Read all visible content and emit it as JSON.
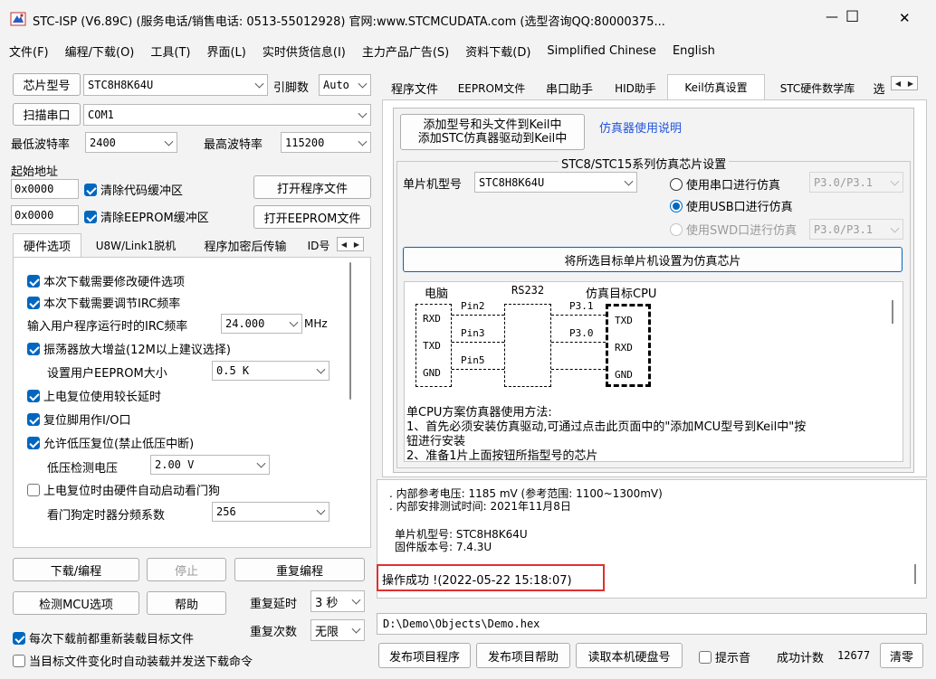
{
  "window": {
    "title": "STC-ISP (V6.89C) (服务电话/销售电话: 0513-55012928) 官网:www.STCMCUDATA.com  (选型咨询QQ:80000375...",
    "min_glyph": "—",
    "max_glyph": "☐",
    "close_glyph": "✕"
  },
  "menu": [
    "文件(F)",
    "编程/下载(O)",
    "工具(T)",
    "界面(L)",
    "实时供货信息(I)",
    "主力产品广告(S)",
    "资料下载(D)",
    "Simplified Chinese",
    "English"
  ],
  "left": {
    "chip_btn": "芯片型号",
    "chip_value": "STC8H8K64U",
    "pins_label": "引脚数",
    "pins_value": "Auto",
    "scan_btn": "扫描串口",
    "port_value": "COM1",
    "min_baud_label": "最低波特率",
    "min_baud_value": "2400",
    "max_baud_label": "最高波特率",
    "max_baud_value": "115200",
    "start_addr_label": "起始地址",
    "addr1": "0x0000",
    "clear_code": "清除代码缓冲区",
    "open_prog": "打开程序文件",
    "addr2": "0x0000",
    "clear_eeprom": "清除EEPROM缓冲区",
    "open_eeprom": "打开EEPROM文件",
    "tabs": [
      "硬件选项",
      "U8W/Link1脱机",
      "程序加密后传输",
      "ID号"
    ],
    "opts": {
      "o1": "本次下载需要修改硬件选项",
      "o2": "本次下载需要调节IRC频率",
      "irc_label": "输入用户程序运行时的IRC频率",
      "irc_value": "24.000",
      "irc_unit": "MHz",
      "o3": "振荡器放大增益(12M以上建议选择)",
      "eeprom_label": "设置用户EEPROM大小",
      "eeprom_value": "0.5 K",
      "o4": "上电复位使用较长延时",
      "o5": "复位脚用作I/O口",
      "o6": "允许低压复位(禁止低压中断)",
      "lv_label": "低压检测电压",
      "lv_value": "2.00 V",
      "o7": "上电复位时由硬件自动启动看门狗",
      "wdt_label": "看门狗定时器分频系数",
      "wdt_value": "256"
    },
    "download": "下载/编程",
    "stop": "停止",
    "reprogram": "重复编程",
    "check_mcu": "检测MCU选项",
    "help": "帮助",
    "repeat_delay_label": "重复延时",
    "repeat_delay_value": "3 秒",
    "repeat_count_label": "重复次数",
    "repeat_count_value": "无限",
    "reload1": "每次下载前都重新装载目标文件",
    "reload2": "当目标文件变化时自动装载并发送下载命令"
  },
  "right": {
    "tabs": [
      "程序文件",
      "EEPROM文件",
      "串口助手",
      "HID助手",
      "Keil仿真设置",
      "STC硬件数学库",
      "选"
    ],
    "keil_btn_line1": "添加型号和头文件到Keil中",
    "keil_btn_line2": "添加STC仿真器驱动到Keil中",
    "emu_link": "仿真器使用说明",
    "group_title": "STC8/STC15系列仿真芯片设置",
    "mcu_label": "单片机型号",
    "mcu_value": "STC8H8K64U",
    "r_serial": "使用串口进行仿真",
    "serial_pins": "P3.0/P3.1",
    "r_usb": "使用USB口进行仿真",
    "r_swd": "使用SWD口进行仿真",
    "swd_pins": "P3.0/P3.1",
    "set_chip_btn": "将所选目标单片机设置为仿真芯片",
    "diagram": {
      "pc": "电脑",
      "rs232": "RS232",
      "target": "仿真目标CPU",
      "rxd": "RXD",
      "txd": "TXD",
      "gnd": "GND",
      "txd2": "TXD",
      "rxd2": "RXD",
      "gnd2": "GND",
      "pin2": "Pin2",
      "pin3": "Pin3",
      "pin5": "Pin5",
      "p31": "P3.1",
      "p30": "P3.0"
    },
    "instr_line1": "单CPU方案仿真器使用方法:",
    "instr_line2": "1、首先必须安装仿真驱动,可通过点击此页面中的\"添加MCU型号到Keil中\"按",
    "instr_line3": "钮进行安装",
    "instr_line4": "2、准备1片上面按钮所指型号的芯片",
    "log_line1": ". 内部参考电压: 1185 mV (参考范围: 1100~1300mV)",
    "log_line2": ". 内部安排测试时间: 2021年11月8日",
    "log_line3": "单片机型号: STC8H8K64U",
    "log_line4": "固件版本号: 7.4.3U",
    "log_success": "操作成功 !(2022-05-22 15:18:07)",
    "file_path": "D:\\Demo\\Objects\\Demo.hex",
    "publish_prog": "发布项目程序",
    "publish_help": "发布项目帮助",
    "read_disk": "读取本机硬盘号",
    "tip_sound": "提示音",
    "success_count_label": "成功计数",
    "success_count": "12677",
    "clear_btn": "清零"
  },
  "colors": {
    "accent": "#0067c0",
    "highlight_border": "#e03030",
    "link": "#2255dd"
  }
}
